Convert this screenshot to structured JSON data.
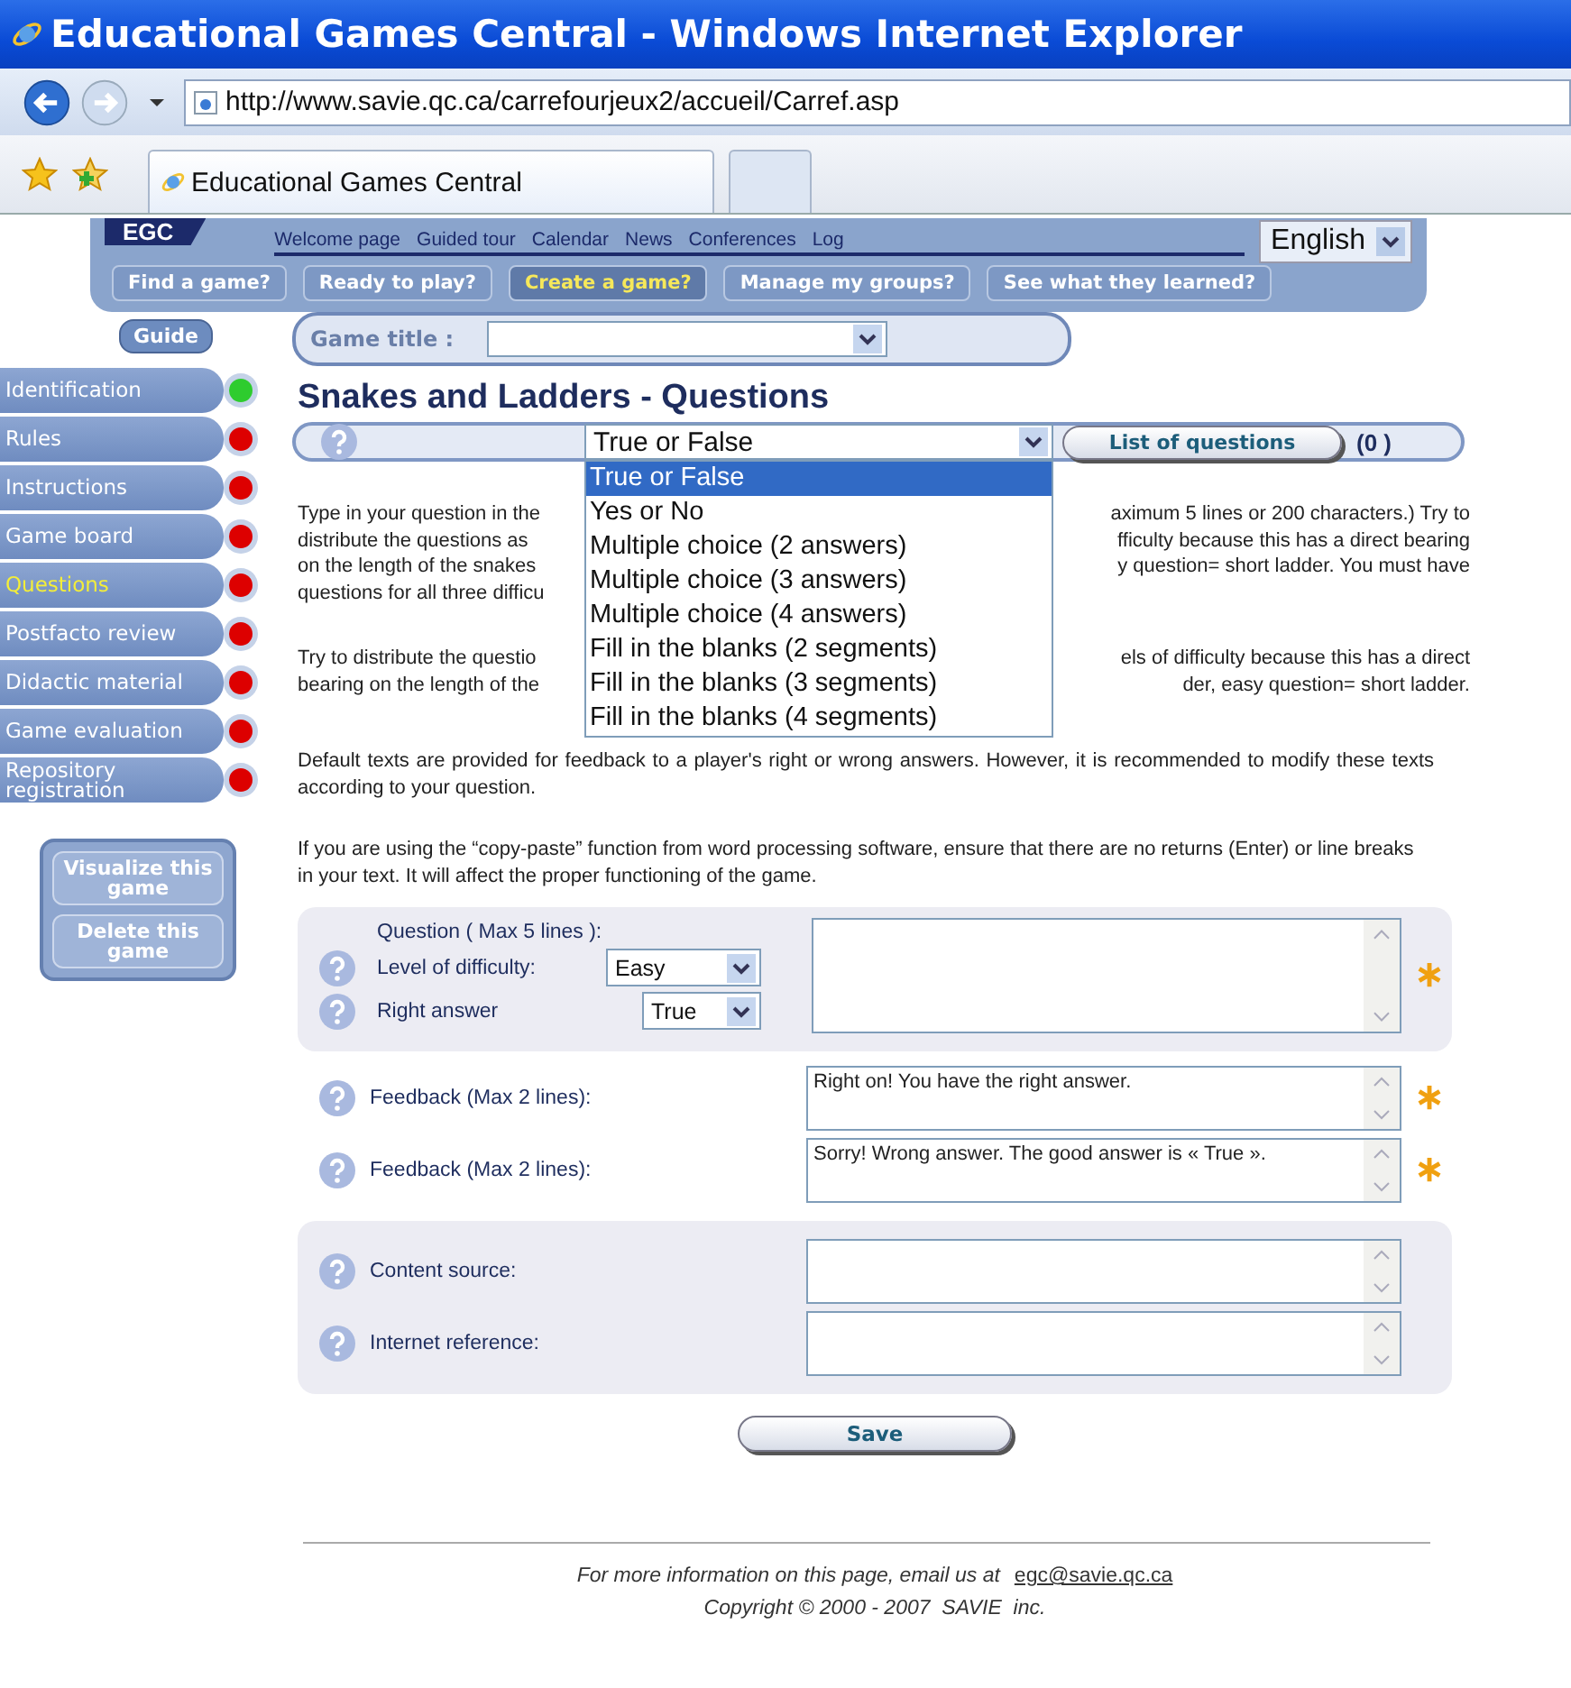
{
  "window": {
    "title": "Educational Games Central - Windows Internet Explorer"
  },
  "address_bar": {
    "url": "http://www.savie.qc.ca/carrefourjeux2/accueil/Carref.asp"
  },
  "browser_tabs": [
    {
      "label": "Educational Games Central",
      "selected": true
    },
    {
      "selected": false
    }
  ],
  "site_header": {
    "logo": "EGC",
    "links": [
      "Welcome page",
      "Guided tour",
      "Calendar",
      "News",
      "Conferences",
      "Log"
    ],
    "language": "English",
    "tabs": [
      {
        "label": "Find a game?",
        "selected": false
      },
      {
        "label": "Ready to play?",
        "selected": false
      },
      {
        "label": "Create a game?",
        "selected": true
      },
      {
        "label": "Manage my groups?",
        "selected": false
      },
      {
        "label": "See what they learned?",
        "selected": false
      }
    ]
  },
  "sidebar": {
    "guide": "Guide",
    "items": [
      {
        "label": "Identification",
        "selected": false,
        "color": "#2ecc2e"
      },
      {
        "label": "Rules",
        "selected": false,
        "color": "#dd0000"
      },
      {
        "label": "Instructions",
        "selected": false,
        "color": "#dd0000"
      },
      {
        "label": "Game board",
        "selected": false,
        "color": "#dd0000"
      },
      {
        "label": "Questions",
        "selected": true,
        "color": "#dd0000"
      },
      {
        "label": "Postfacto review",
        "selected": false,
        "color": "#dd0000"
      },
      {
        "label": "Didactic material",
        "selected": false,
        "color": "#dd0000"
      },
      {
        "label": "Game evaluation",
        "selected": false,
        "color": "#dd0000"
      },
      {
        "label": "Repository registration",
        "selected": false,
        "color": "#dd0000"
      }
    ],
    "buttons": [
      "Visualize this game",
      "Delete this game"
    ]
  },
  "game_title": {
    "label": "Game title :"
  },
  "heading": "Snakes and Ladders - Questions",
  "question_type": {
    "value": "True or False",
    "list_button": "List of questions",
    "count": "(0 )",
    "options": [
      {
        "label": "True or False",
        "selected": true
      },
      {
        "label": "Yes or No",
        "selected": false
      },
      {
        "label": "Multiple choice (2 answers)",
        "selected": false
      },
      {
        "label": "Multiple choice (3 answers)",
        "selected": false
      },
      {
        "label": "Multiple choice (4 answers)",
        "selected": false
      },
      {
        "label": "Fill in the blanks (2 segments)",
        "selected": false
      },
      {
        "label": "Fill in the blanks (3 segments)",
        "selected": false
      },
      {
        "label": "Fill in the blanks (4 segments)",
        "selected": false
      }
    ]
  },
  "covered_paragraphs": [
    [
      {
        "left": "Type in your question in the",
        "right": "aximum 5 lines or 200 characters.) Try to"
      },
      {
        "left": "distribute the questions as",
        "right": "fficulty because this has a direct bearing"
      },
      {
        "left": "on the length of the snakes",
        "right": "y question= short ladder. You must have"
      },
      {
        "left": "questions for all three difficu"
      }
    ],
    [
      {
        "left": "Try to distribute the questio",
        "right": "els of difficulty because this has a direct"
      },
      {
        "left": "bearing on the length of the",
        "right": "der, easy question= short ladder."
      }
    ]
  ],
  "paragraphs": [
    "Default texts are provided for feedback to a player's right or wrong answers. However, it is recommended to modify these texts according to your question.",
    "If you are using the “copy-paste” function from word processing software, ensure that there are no returns (Enter) or line breaks in your text. It will affect the proper functioning of the game."
  ],
  "question_panel": {
    "question_label": "Question ( Max 5 lines ):",
    "difficulty_label": "Level of difficulty:",
    "difficulty": "Easy",
    "answer_label": "Right answer",
    "answer": "True",
    "required": true
  },
  "feedback": [
    {
      "label": "Feedback (Max 2 lines):",
      "value": "Right on! You have the right answer.",
      "required": true
    },
    {
      "label": "Feedback (Max 2 lines):",
      "value": "Sorry! Wrong answer. The good answer is « True ».",
      "required": true
    }
  ],
  "sources": [
    {
      "label": "Content source:"
    },
    {
      "label": "Internet reference:"
    }
  ],
  "save_button": "Save",
  "footer": {
    "text": "For more information on this page, email us at",
    "email": "egc@savie.qc.ca",
    "copyright": "Copyright © 2000 - 2007  SAVIE  inc."
  }
}
